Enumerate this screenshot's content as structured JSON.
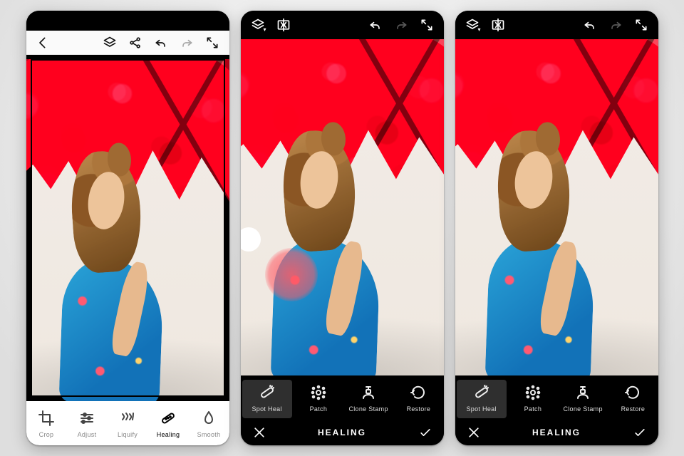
{
  "phones": {
    "left": {
      "toolbar_icons": [
        "back",
        "layers",
        "share",
        "undo",
        "redo",
        "fullscreen"
      ],
      "tools": [
        {
          "key": "crop",
          "label": "Crop"
        },
        {
          "key": "adjust",
          "label": "Adjust"
        },
        {
          "key": "liquify",
          "label": "Liquify"
        },
        {
          "key": "healing",
          "label": "Healing"
        },
        {
          "key": "smooth",
          "label": "Smooth"
        }
      ],
      "active_tool": "healing"
    },
    "middle": {
      "mode_title": "HEALING",
      "toolbar_icons": [
        "layers",
        "compare",
        "undo",
        "redo",
        "fullscreen"
      ],
      "heal_tools": [
        {
          "key": "spotheal",
          "label": "Spot Heal"
        },
        {
          "key": "patch",
          "label": "Patch"
        },
        {
          "key": "clonestamp",
          "label": "Clone Stamp"
        },
        {
          "key": "restore",
          "label": "Restore"
        }
      ],
      "active_tool": "spotheal",
      "show_brush_knob": true,
      "show_heal_blob": true
    },
    "right": {
      "mode_title": "HEALING",
      "toolbar_icons": [
        "layers",
        "compare",
        "undo",
        "redo",
        "fullscreen"
      ],
      "heal_tools": [
        {
          "key": "spotheal",
          "label": "Spot Heal"
        },
        {
          "key": "patch",
          "label": "Patch"
        },
        {
          "key": "clonestamp",
          "label": "Clone Stamp"
        },
        {
          "key": "restore",
          "label": "Restore"
        }
      ],
      "active_tool": "spotheal",
      "show_brush_knob": false,
      "show_heal_blob": false
    }
  },
  "labels": {
    "close": "Close",
    "confirm": "Confirm"
  }
}
